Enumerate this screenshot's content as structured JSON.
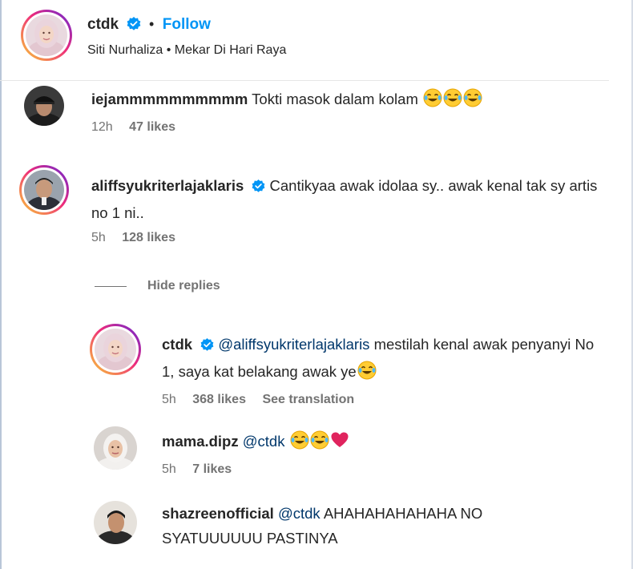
{
  "post": {
    "author": "ctdk",
    "follow_label": "Follow",
    "separator": "•",
    "subtitle": "Siti Nurhaliza • Mekar Di Hari Raya"
  },
  "comments": [
    {
      "username": "iejammmmmmmmmm",
      "text": "Tokti masok dalam kolam",
      "emojis": [
        "laughing-tears",
        "laughing-tears",
        "laughing-tears"
      ],
      "time": "12h",
      "likes": "47 likes",
      "verified": false
    },
    {
      "username": "aliffsyukriterlajaklaris",
      "text": "Cantikyaa awak idolaa sy.. awak kenal tak sy artis no 1 ni..",
      "time": "5h",
      "likes": "128 likes",
      "verified": true
    }
  ],
  "hide_replies_label": "Hide replies",
  "replies": [
    {
      "username": "ctdk",
      "mention": "@aliffsyukriterlajaklaris",
      "text": "mestilah kenal awak penyanyi No 1, saya kat belakang awak ye",
      "emojis": [
        "laughing-tears"
      ],
      "time": "5h",
      "likes": "368 likes",
      "translation_label": "See translation",
      "verified": true
    },
    {
      "username": "mama.dipz",
      "mention": "@ctdk",
      "text": "",
      "emojis": [
        "laughing-tears",
        "laughing-tears",
        "red-heart"
      ],
      "time": "5h",
      "likes": "7 likes",
      "verified": false
    },
    {
      "username": "shazreenofficial",
      "mention": "@ctdk",
      "text": "AHAHAHAHAHAHA NO SYATUUUUUU PASTINYA",
      "verified": false
    }
  ],
  "colors": {
    "follow": "#0095f6",
    "verified": "#0095f6",
    "mention": "#00376b",
    "meta": "#737373",
    "heart": "#e0245e"
  }
}
